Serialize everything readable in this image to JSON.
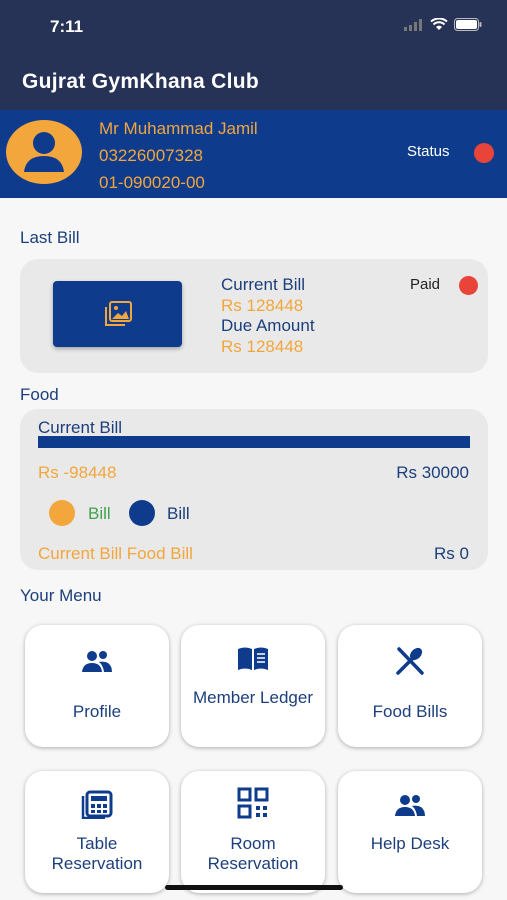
{
  "status_bar": {
    "time": "7:11"
  },
  "header": {
    "title": "Gujrat GymKhana Club"
  },
  "member": {
    "name": "Mr Muhammad Jamil",
    "phone": "03226007328",
    "id": "01-090020-00",
    "status_label": "Status",
    "status_color": "#e8443a"
  },
  "last_bill": {
    "section_title": "Last Bill",
    "current_bill_label": "Current Bill",
    "current_bill_amount": "Rs 128448",
    "due_amount_label": "Due Amount",
    "due_amount_value": "Rs 128448",
    "paid_label": "Paid"
  },
  "food": {
    "section_title": "Food",
    "current_bill_label": "Current Bill",
    "left_amount": "Rs -98448",
    "right_amount": "Rs 30000",
    "legend": [
      "Bill",
      "Bill"
    ],
    "footer_label": "Current Bill Food Bill",
    "footer_amount": "Rs 0"
  },
  "menu": {
    "section_title": "Your Menu",
    "items": [
      {
        "label": "Profile",
        "icon": "people-icon"
      },
      {
        "label": "Member Ledger",
        "icon": "book-icon"
      },
      {
        "label": "Food Bills",
        "icon": "utensils-icon"
      },
      {
        "label": "Table Reservation",
        "icon": "calculator-icon"
      },
      {
        "label": "Room Reservation",
        "icon": "grid-icon"
      },
      {
        "label": "Help Desk",
        "icon": "people-icon"
      }
    ]
  },
  "colors": {
    "header": "#273257",
    "brand_blue": "#0e3b8c",
    "accent_orange": "#f2a63c",
    "alert_red": "#e8443a",
    "legend_green_text": "#3fa34d"
  }
}
